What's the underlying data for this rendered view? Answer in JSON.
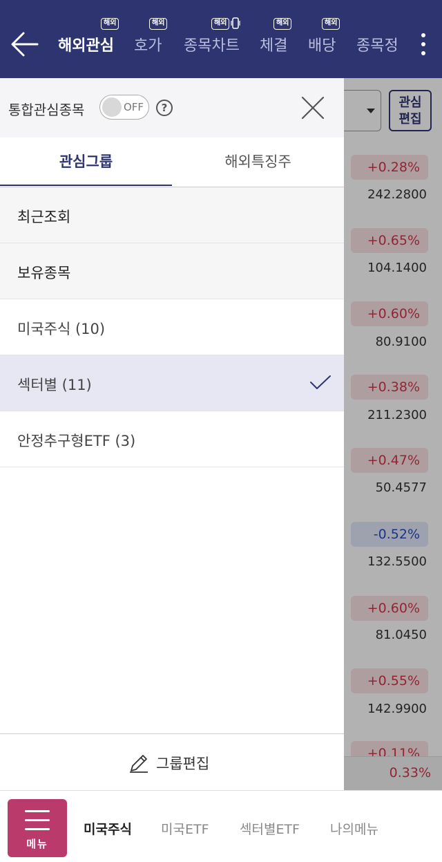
{
  "topnav": {
    "tabs": [
      {
        "label": "해외관심",
        "badge": "해외"
      },
      {
        "label": "호가",
        "badge": "해외"
      },
      {
        "label": "종목차트",
        "badge": "해외"
      },
      {
        "label": "체결",
        "badge": "해외"
      },
      {
        "label": "배당",
        "badge": "해외"
      },
      {
        "label": "종목정",
        "badge": ""
      }
    ]
  },
  "background": {
    "edit_button": "관심\n편집",
    "rows": [
      {
        "pct": "+0.28%",
        "price": "242.2800",
        "dir": "up"
      },
      {
        "pct": "+0.65%",
        "price": "104.1400",
        "dir": "up"
      },
      {
        "pct": "+0.60%",
        "price": "80.9100",
        "dir": "up"
      },
      {
        "pct": "+0.38%",
        "price": "211.2300",
        "dir": "up"
      },
      {
        "pct": "+0.47%",
        "price": "50.4577",
        "dir": "up"
      },
      {
        "pct": "-0.52%",
        "price": "132.5500",
        "dir": "down"
      },
      {
        "pct": "+0.60%",
        "price": "81.0450",
        "dir": "up"
      },
      {
        "pct": "+0.55%",
        "price": "142.9900",
        "dir": "up"
      },
      {
        "pct": "+0.11%",
        "price": "",
        "dir": "up"
      }
    ],
    "summary_pct": "0.33%"
  },
  "drawer": {
    "title": "통합관심종목",
    "toggle_label": "OFF",
    "help": "?",
    "tabs": [
      "관심그룹",
      "해외특징주"
    ],
    "groups": [
      {
        "label": "최근조회",
        "style": "gray"
      },
      {
        "label": "보유종목",
        "style": "gray"
      },
      {
        "label": "미국주식 (10)",
        "style": "plain"
      },
      {
        "label": "섹터별 (11)",
        "style": "selected"
      },
      {
        "label": "안정추구형ETF (3)",
        "style": "plain"
      }
    ],
    "group_edit": "그룹편집"
  },
  "bottomnav": {
    "menu_label": "메뉴",
    "items": [
      "미국주식",
      "미국ETF",
      "섹터별ETF",
      "나의메뉴"
    ]
  },
  "colors": {
    "header": "#2e3470",
    "menu_button": "#b93a6b",
    "up": "#d1344a",
    "down": "#2a4bbf"
  }
}
